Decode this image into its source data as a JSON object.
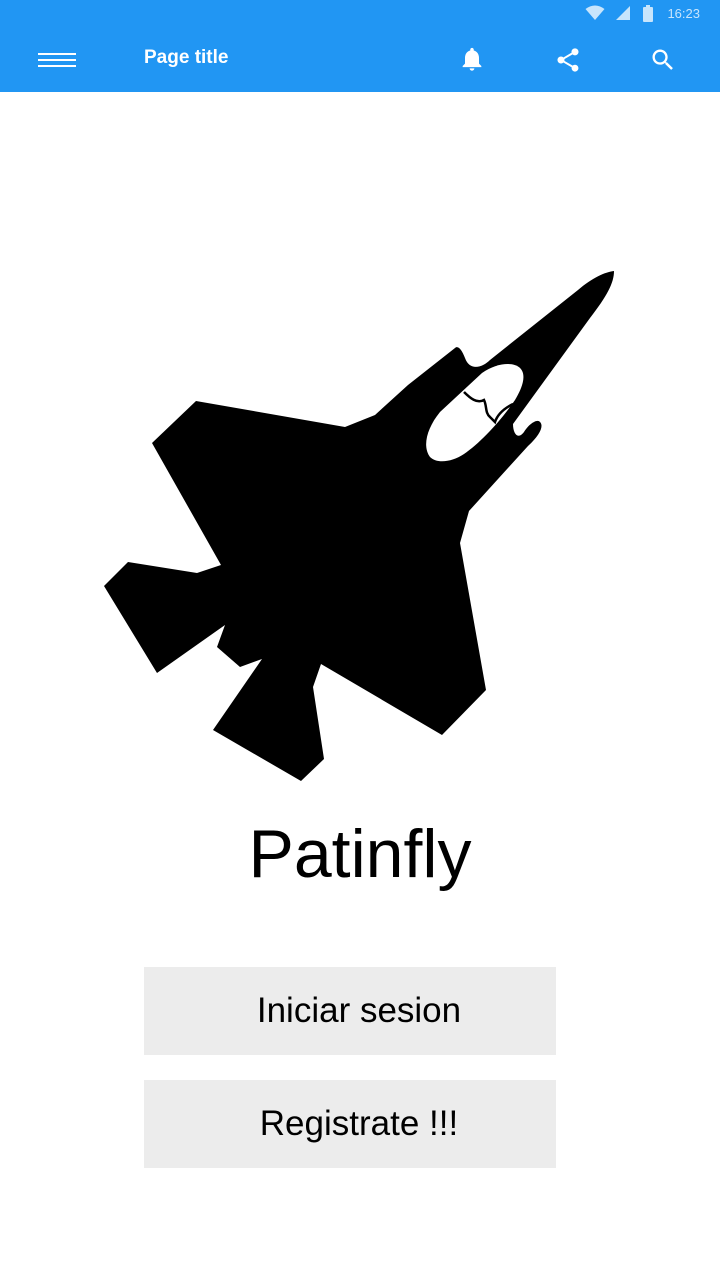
{
  "status_bar": {
    "time": "16:23",
    "icons": [
      "wifi-icon",
      "signal-icon",
      "battery-icon"
    ]
  },
  "app_bar": {
    "title": "Page title",
    "background_color": "#2196F3",
    "actions": [
      "menu-icon",
      "bell-icon",
      "share-icon",
      "search-icon"
    ]
  },
  "main": {
    "logo": "fighter-jet-icon",
    "app_name": "Patinfly",
    "buttons": {
      "login": "Iniciar sesion",
      "register": "Registrate !!!"
    },
    "button_color": "#ececec"
  }
}
